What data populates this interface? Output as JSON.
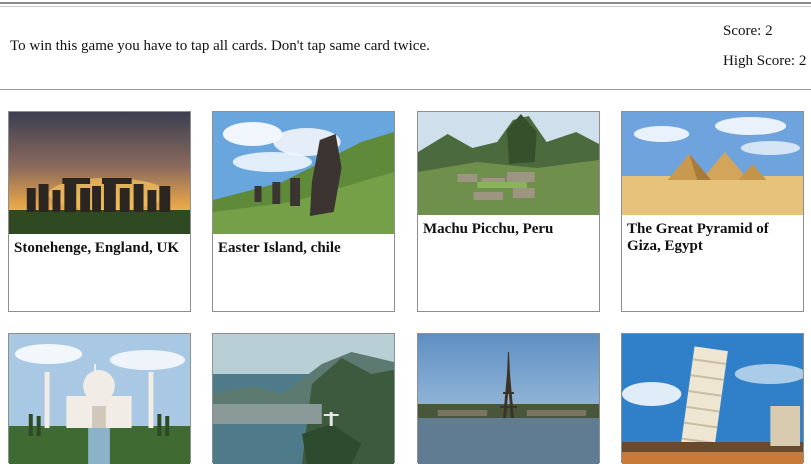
{
  "header": {
    "instructions": "To win this game you have to tap all cards. Don't tap same card twice.",
    "score": "Score: 2",
    "high_score": "High Score: 2"
  },
  "cards": [
    {
      "title": "Stonehenge, England, UK",
      "image": "stonehenge-photo"
    },
    {
      "title": "Easter Island, chile",
      "image": "easter-island-photo"
    },
    {
      "title": "Machu Picchu, Peru",
      "image": "machu-picchu-photo"
    },
    {
      "title": "The Great Pyramid of Giza, Egypt",
      "image": "giza-pyramids-photo"
    },
    {
      "title": "",
      "image": "taj-mahal-photo"
    },
    {
      "title": "",
      "image": "rio-christ-redeemer-photo"
    },
    {
      "title": "",
      "image": "eiffel-tower-photo"
    },
    {
      "title": "",
      "image": "leaning-tower-pisa-photo"
    }
  ]
}
